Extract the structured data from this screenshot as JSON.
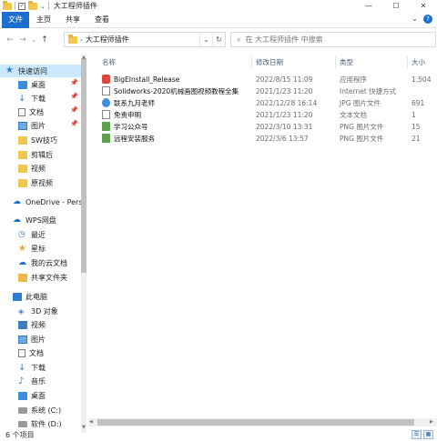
{
  "window": {
    "title": "大工程师插件",
    "controls": [
      "—",
      "☐",
      "✕"
    ]
  },
  "ribbon": {
    "tabs": [
      "文件",
      "主页",
      "共享",
      "查看"
    ],
    "expand_icon": "⌄",
    "help_icon": "?"
  },
  "nav": {
    "back": "←",
    "forward": "→",
    "recent": "⌄",
    "up": "↑",
    "address": "大工程师插件",
    "refresh": "↻",
    "dropdown": "⌄",
    "search_placeholder": "在 大工程师插件 中搜索"
  },
  "sidebar": {
    "items": [
      {
        "label": "快速访问",
        "icon": "star-icon",
        "pinned": false
      },
      {
        "label": "桌面",
        "icon": "desktop-icon",
        "pinned": true
      },
      {
        "label": "下载",
        "icon": "download-icon",
        "pinned": true
      },
      {
        "label": "文档",
        "icon": "document-icon",
        "pinned": true
      },
      {
        "label": "图片",
        "icon": "pictures-icon",
        "pinned": true
      },
      {
        "label": "SW技巧",
        "icon": "folder-icon",
        "pinned": false
      },
      {
        "label": "剪辑后",
        "icon": "folder-icon",
        "pinned": false
      },
      {
        "label": "视频",
        "icon": "folder-icon",
        "pinned": false
      },
      {
        "label": "原视频",
        "icon": "folder-icon",
        "pinned": false
      },
      {
        "label": "OneDrive - Pers",
        "icon": "onedrive-icon",
        "pinned": false
      },
      {
        "label": "WPS网盘",
        "icon": "wps-cloud-icon",
        "pinned": false
      },
      {
        "label": "最近",
        "icon": "recent-icon",
        "pinned": false
      },
      {
        "label": "星标",
        "icon": "star-mark-icon",
        "pinned": false
      },
      {
        "label": "我的云文档",
        "icon": "cloud-docs-icon",
        "pinned": false
      },
      {
        "label": "共享文件夹",
        "icon": "shared-folder-icon",
        "pinned": false
      },
      {
        "label": "此电脑",
        "icon": "pc-icon",
        "pinned": false
      },
      {
        "label": "3D 对象",
        "icon": "3d-objects-icon",
        "pinned": false
      },
      {
        "label": "视频",
        "icon": "videos-icon",
        "pinned": false
      },
      {
        "label": "图片",
        "icon": "pictures-icon",
        "pinned": false
      },
      {
        "label": "文档",
        "icon": "document-icon",
        "pinned": false
      },
      {
        "label": "下载",
        "icon": "download-icon",
        "pinned": false
      },
      {
        "label": "音乐",
        "icon": "music-icon",
        "pinned": false
      },
      {
        "label": "桌面",
        "icon": "desktop-icon",
        "pinned": false
      },
      {
        "label": "系统 (C:)",
        "icon": "drive-icon",
        "pinned": false
      },
      {
        "label": "软件 (D:)",
        "icon": "drive-icon",
        "pinned": false
      }
    ]
  },
  "columns": [
    "名称",
    "修改日期",
    "类型",
    "大小"
  ],
  "files": [
    {
      "name": "BigEInstall_Release",
      "date": "2022/8/15 11:09",
      "type": "应用程序",
      "size": "1,504",
      "icon": "app-icon"
    },
    {
      "name": "Solidworks-2020机械画图视频教程全集",
      "date": "2021/1/23 11:20",
      "type": "Internet 快捷方式",
      "size": "",
      "icon": "shortcut-icon"
    },
    {
      "name": "联系九月老师",
      "date": "2022/12/28 16:14",
      "type": "JPG 图片文件",
      "size": "691",
      "icon": "jpg-icon"
    },
    {
      "name": "免责申明",
      "date": "2021/1/23 11:20",
      "type": "文本文档",
      "size": "1",
      "icon": "text-file-icon"
    },
    {
      "name": "学习公众号",
      "date": "2022/3/10 13:31",
      "type": "PNG 图片文件",
      "size": "15",
      "icon": "png-icon"
    },
    {
      "name": "远程安装服务",
      "date": "2022/3/6 13:57",
      "type": "PNG 图片文件",
      "size": "21",
      "icon": "png-icon"
    }
  ],
  "status": {
    "count": "6 个项目"
  }
}
